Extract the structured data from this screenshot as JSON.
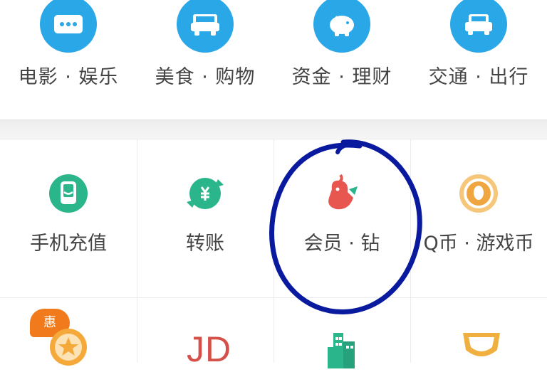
{
  "top_categories": [
    {
      "label": "电影 · 娱乐",
      "icon": "movie-icon"
    },
    {
      "label": "美食 · 购物",
      "icon": "shopping-cart-icon"
    },
    {
      "label": "资金 · 理财",
      "icon": "piggy-bank-icon"
    },
    {
      "label": "交通 · 出行",
      "icon": "car-icon"
    }
  ],
  "grid_items": [
    {
      "label": "手机充值",
      "icon": "phone-recharge-icon",
      "color": "#2bb58a"
    },
    {
      "label": "转账",
      "icon": "transfer-icon",
      "color": "#2bb58a"
    },
    {
      "label": "会员 · 钻",
      "icon": "member-diamond-icon",
      "color": "#e8574f"
    },
    {
      "label": "Q币 · 游戏币",
      "icon": "q-coin-icon",
      "color": "#f0a640"
    }
  ],
  "third_row": {
    "badge_text": "惠",
    "jd_text": "JD"
  },
  "colors": {
    "top_icon_bg": "#2aa7e6",
    "annotation": "#0a1a9e"
  }
}
